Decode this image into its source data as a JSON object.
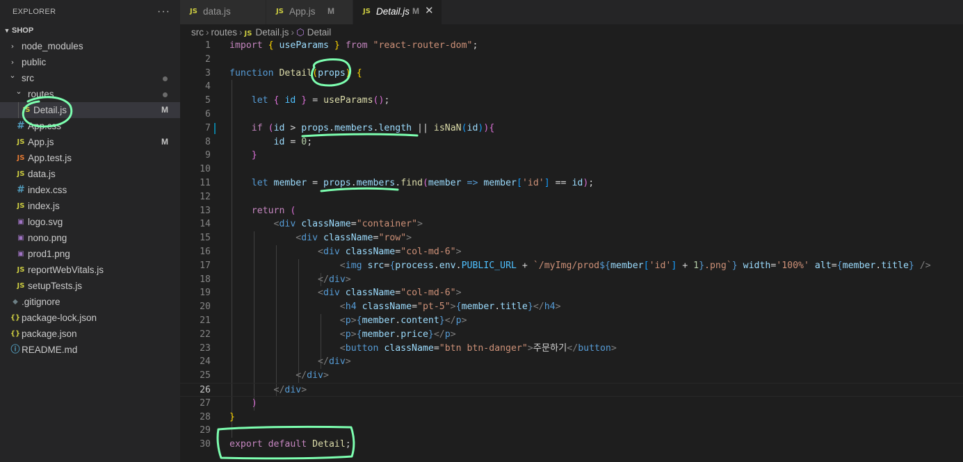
{
  "explorer": {
    "title": "EXPLORER",
    "more": "···",
    "project": "SHOP",
    "items": [
      {
        "label": "node_modules",
        "kind": "folder",
        "icon": "chevron-right-icon",
        "glyph": "›",
        "depth": 0
      },
      {
        "label": "public",
        "kind": "folder",
        "icon": "chevron-right-icon",
        "glyph": "›",
        "depth": 0
      },
      {
        "label": "src",
        "kind": "folder",
        "icon": "chevron-down-icon",
        "glyph": "⌄",
        "depth": 0,
        "dot": true
      },
      {
        "label": "routes",
        "kind": "folder",
        "icon": "chevron-down-icon",
        "glyph": "⌄",
        "depth": 1,
        "dot": true
      },
      {
        "label": "Detail.js",
        "kind": "file",
        "icon": "js-file-icon",
        "glyph": "JS",
        "depth": 2,
        "badge": "M",
        "selected": true
      },
      {
        "label": "App.css",
        "kind": "file",
        "icon": "css-file-icon",
        "glyph": "#",
        "depth": 1
      },
      {
        "label": "App.js",
        "kind": "file",
        "icon": "js-file-icon",
        "glyph": "JS",
        "depth": 1,
        "badge": "M"
      },
      {
        "label": "App.test.js",
        "kind": "file",
        "icon": "test-js-file-icon",
        "glyph": "JS",
        "depth": 1
      },
      {
        "label": "data.js",
        "kind": "file",
        "icon": "js-file-icon",
        "glyph": "JS",
        "depth": 1
      },
      {
        "label": "index.css",
        "kind": "file",
        "icon": "css-file-icon",
        "glyph": "#",
        "depth": 1
      },
      {
        "label": "index.js",
        "kind": "file",
        "icon": "js-file-icon",
        "glyph": "JS",
        "depth": 1
      },
      {
        "label": "logo.svg",
        "kind": "file",
        "icon": "image-file-icon",
        "glyph": "▣",
        "depth": 1
      },
      {
        "label": "nono.png",
        "kind": "file",
        "icon": "image-file-icon",
        "glyph": "▣",
        "depth": 1
      },
      {
        "label": "prod1.png",
        "kind": "file",
        "icon": "image-file-icon",
        "glyph": "▣",
        "depth": 1
      },
      {
        "label": "reportWebVitals.js",
        "kind": "file",
        "icon": "js-file-icon",
        "glyph": "JS",
        "depth": 1
      },
      {
        "label": "setupTests.js",
        "kind": "file",
        "icon": "js-file-icon",
        "glyph": "JS",
        "depth": 1
      },
      {
        "label": ".gitignore",
        "kind": "file",
        "icon": "git-icon",
        "glyph": "◆",
        "depth": 0
      },
      {
        "label": "package-lock.json",
        "kind": "file",
        "icon": "json-file-icon",
        "glyph": "{}",
        "depth": 0
      },
      {
        "label": "package.json",
        "kind": "file",
        "icon": "json-file-icon",
        "glyph": "{}",
        "depth": 0
      },
      {
        "label": "README.md",
        "kind": "file",
        "icon": "info-icon",
        "glyph": "ⓘ",
        "depth": 0
      }
    ]
  },
  "tabs": [
    {
      "label": "data.js",
      "icon": "JS",
      "modified": "",
      "active": false
    },
    {
      "label": "App.js",
      "icon": "JS",
      "modified": "M",
      "active": false
    },
    {
      "label": "Detail.js",
      "icon": "JS",
      "modified": "M",
      "active": true,
      "close": "✕"
    }
  ],
  "breadcrumb": {
    "parts": [
      "src",
      "routes",
      "Detail.js",
      "Detail"
    ],
    "file_icon": "JS",
    "symbol_icon": "⬡"
  },
  "editor": {
    "current_line": 26,
    "modified_lines": [
      7
    ],
    "lines": [
      {
        "n": "1",
        "t": [
          [
            "kw",
            "import"
          ],
          [
            "tx",
            " "
          ],
          [
            "br1",
            "{"
          ],
          [
            "tx",
            " "
          ],
          [
            "vr",
            "useParams"
          ],
          [
            "tx",
            " "
          ],
          [
            "br1",
            "}"
          ],
          [
            "tx",
            " "
          ],
          [
            "kw",
            "from"
          ],
          [
            "tx",
            " "
          ],
          [
            "st",
            "\"react-router-dom\""
          ],
          [
            "tx",
            ";"
          ]
        ]
      },
      {
        "n": "2",
        "t": []
      },
      {
        "n": "3",
        "t": [
          [
            "kb",
            "function"
          ],
          [
            "tx",
            " "
          ],
          [
            "fn",
            "Detail"
          ],
          [
            "br1",
            "("
          ],
          [
            "vr",
            "props"
          ],
          [
            "br1",
            ")"
          ],
          [
            "tx",
            " "
          ],
          [
            "br1",
            "{"
          ]
        ]
      },
      {
        "n": "4",
        "t": []
      },
      {
        "n": "5",
        "t": [
          [
            "tx",
            "    "
          ],
          [
            "kb",
            "let"
          ],
          [
            "tx",
            " "
          ],
          [
            "br2",
            "{"
          ],
          [
            "tx",
            " "
          ],
          [
            "cn",
            "id"
          ],
          [
            "tx",
            " "
          ],
          [
            "br2",
            "}"
          ],
          [
            "tx",
            " = "
          ],
          [
            "fn",
            "useParams"
          ],
          [
            "br2",
            "("
          ],
          [
            "br2",
            ")"
          ],
          [
            "tx",
            ";"
          ]
        ]
      },
      {
        "n": "6",
        "t": []
      },
      {
        "n": "7",
        "t": [
          [
            "tx",
            "    "
          ],
          [
            "kw",
            "if"
          ],
          [
            "tx",
            " "
          ],
          [
            "br2",
            "("
          ],
          [
            "vr",
            "id"
          ],
          [
            "tx",
            " > "
          ],
          [
            "vr",
            "props"
          ],
          [
            "tx",
            "."
          ],
          [
            "vr",
            "members"
          ],
          [
            "tx",
            "."
          ],
          [
            "vr",
            "length"
          ],
          [
            "tx",
            " || "
          ],
          [
            "fn",
            "isNaN"
          ],
          [
            "br3",
            "("
          ],
          [
            "vr",
            "id"
          ],
          [
            "br3",
            ")"
          ],
          [
            "br2",
            ")"
          ],
          [
            "br2",
            "{"
          ]
        ]
      },
      {
        "n": "8",
        "t": [
          [
            "tx",
            "        "
          ],
          [
            "vr",
            "id"
          ],
          [
            "tx",
            " = "
          ],
          [
            "nm",
            "0"
          ],
          [
            "tx",
            ";"
          ]
        ]
      },
      {
        "n": "9",
        "t": [
          [
            "tx",
            "    "
          ],
          [
            "br2",
            "}"
          ]
        ]
      },
      {
        "n": "10",
        "t": []
      },
      {
        "n": "11",
        "t": [
          [
            "tx",
            "    "
          ],
          [
            "kb",
            "let"
          ],
          [
            "tx",
            " "
          ],
          [
            "vr",
            "member"
          ],
          [
            "tx",
            " = "
          ],
          [
            "vr",
            "props"
          ],
          [
            "tx",
            "."
          ],
          [
            "vr",
            "members"
          ],
          [
            "tx",
            "."
          ],
          [
            "fn",
            "find"
          ],
          [
            "br2",
            "("
          ],
          [
            "vr",
            "member"
          ],
          [
            "tx",
            " "
          ],
          [
            "kb",
            "=>"
          ],
          [
            "tx",
            " "
          ],
          [
            "vr",
            "member"
          ],
          [
            "br3",
            "["
          ],
          [
            "st",
            "'id'"
          ],
          [
            "br3",
            "]"
          ],
          [
            "tx",
            " == "
          ],
          [
            "vr",
            "id"
          ],
          [
            "br2",
            ")"
          ],
          [
            "tx",
            ";"
          ]
        ]
      },
      {
        "n": "12",
        "t": []
      },
      {
        "n": "13",
        "t": [
          [
            "tx",
            "    "
          ],
          [
            "kw",
            "return"
          ],
          [
            "tx",
            " "
          ],
          [
            "br2",
            "("
          ]
        ]
      },
      {
        "n": "14",
        "t": [
          [
            "tx",
            "        "
          ],
          [
            "pu",
            "<"
          ],
          [
            "tg",
            "div"
          ],
          [
            "tx",
            " "
          ],
          [
            "vr",
            "className"
          ],
          [
            "tx",
            "="
          ],
          [
            "st",
            "\"container\""
          ],
          [
            "pu",
            ">"
          ]
        ]
      },
      {
        "n": "15",
        "t": [
          [
            "tx",
            "            "
          ],
          [
            "pu",
            "<"
          ],
          [
            "tg",
            "div"
          ],
          [
            "tx",
            " "
          ],
          [
            "vr",
            "className"
          ],
          [
            "tx",
            "="
          ],
          [
            "st",
            "\"row\""
          ],
          [
            "pu",
            ">"
          ]
        ]
      },
      {
        "n": "16",
        "t": [
          [
            "tx",
            "                "
          ],
          [
            "pu",
            "<"
          ],
          [
            "tg",
            "div"
          ],
          [
            "tx",
            " "
          ],
          [
            "vr",
            "className"
          ],
          [
            "tx",
            "="
          ],
          [
            "st",
            "\"col-md-6\""
          ],
          [
            "pu",
            ">"
          ]
        ]
      },
      {
        "n": "17",
        "t": [
          [
            "tx",
            "                    "
          ],
          [
            "pu",
            "<"
          ],
          [
            "tg",
            "img"
          ],
          [
            "tx",
            " "
          ],
          [
            "vr",
            "src"
          ],
          [
            "tx",
            "="
          ],
          [
            "kb",
            "{"
          ],
          [
            "vr",
            "process"
          ],
          [
            "tx",
            "."
          ],
          [
            "vr",
            "env"
          ],
          [
            "tx",
            "."
          ],
          [
            "cn",
            "PUBLIC_URL"
          ],
          [
            "tx",
            " + "
          ],
          [
            "st",
            "`/myImg/prod"
          ],
          [
            "kb",
            "${"
          ],
          [
            "vr",
            "member"
          ],
          [
            "br3",
            "["
          ],
          [
            "st",
            "'id'"
          ],
          [
            "br3",
            "]"
          ],
          [
            "tx",
            " + "
          ],
          [
            "nm",
            "1"
          ],
          [
            "kb",
            "}"
          ],
          [
            "st",
            ".png`"
          ],
          [
            "kb",
            "}"
          ],
          [
            "tx",
            " "
          ],
          [
            "vr",
            "width"
          ],
          [
            "tx",
            "="
          ],
          [
            "st",
            "'100%'"
          ],
          [
            "tx",
            " "
          ],
          [
            "vr",
            "alt"
          ],
          [
            "tx",
            "="
          ],
          [
            "kb",
            "{"
          ],
          [
            "vr",
            "member"
          ],
          [
            "tx",
            "."
          ],
          [
            "vr",
            "title"
          ],
          [
            "kb",
            "}"
          ],
          [
            "tx",
            " "
          ],
          [
            "pu",
            "/>"
          ]
        ]
      },
      {
        "n": "18",
        "t": [
          [
            "tx",
            "                "
          ],
          [
            "pu",
            "</"
          ],
          [
            "tg",
            "div"
          ],
          [
            "pu",
            ">"
          ]
        ]
      },
      {
        "n": "19",
        "t": [
          [
            "tx",
            "                "
          ],
          [
            "pu",
            "<"
          ],
          [
            "tg",
            "div"
          ],
          [
            "tx",
            " "
          ],
          [
            "vr",
            "className"
          ],
          [
            "tx",
            "="
          ],
          [
            "st",
            "\"col-md-6\""
          ],
          [
            "pu",
            ">"
          ]
        ]
      },
      {
        "n": "20",
        "t": [
          [
            "tx",
            "                    "
          ],
          [
            "pu",
            "<"
          ],
          [
            "tg",
            "h4"
          ],
          [
            "tx",
            " "
          ],
          [
            "vr",
            "className"
          ],
          [
            "tx",
            "="
          ],
          [
            "st",
            "\"pt-5\""
          ],
          [
            "pu",
            ">"
          ],
          [
            "kb",
            "{"
          ],
          [
            "vr",
            "member"
          ],
          [
            "tx",
            "."
          ],
          [
            "vr",
            "title"
          ],
          [
            "kb",
            "}"
          ],
          [
            "pu",
            "</"
          ],
          [
            "tg",
            "h4"
          ],
          [
            "pu",
            ">"
          ]
        ]
      },
      {
        "n": "21",
        "t": [
          [
            "tx",
            "                    "
          ],
          [
            "pu",
            "<"
          ],
          [
            "tg",
            "p"
          ],
          [
            "pu",
            ">"
          ],
          [
            "kb",
            "{"
          ],
          [
            "vr",
            "member"
          ],
          [
            "tx",
            "."
          ],
          [
            "vr",
            "content"
          ],
          [
            "kb",
            "}"
          ],
          [
            "pu",
            "</"
          ],
          [
            "tg",
            "p"
          ],
          [
            "pu",
            ">"
          ]
        ]
      },
      {
        "n": "22",
        "t": [
          [
            "tx",
            "                    "
          ],
          [
            "pu",
            "<"
          ],
          [
            "tg",
            "p"
          ],
          [
            "pu",
            ">"
          ],
          [
            "kb",
            "{"
          ],
          [
            "vr",
            "member"
          ],
          [
            "tx",
            "."
          ],
          [
            "vr",
            "price"
          ],
          [
            "kb",
            "}"
          ],
          [
            "pu",
            "</"
          ],
          [
            "tg",
            "p"
          ],
          [
            "pu",
            ">"
          ]
        ]
      },
      {
        "n": "23",
        "t": [
          [
            "tx",
            "                    "
          ],
          [
            "pu",
            "<"
          ],
          [
            "tg",
            "button"
          ],
          [
            "tx",
            " "
          ],
          [
            "vr",
            "className"
          ],
          [
            "tx",
            "="
          ],
          [
            "st",
            "\"btn btn-danger\""
          ],
          [
            "pu",
            ">"
          ],
          [
            "tx",
            "주문하기"
          ],
          [
            "pu",
            "</"
          ],
          [
            "tg",
            "button"
          ],
          [
            "pu",
            ">"
          ]
        ]
      },
      {
        "n": "24",
        "t": [
          [
            "tx",
            "                "
          ],
          [
            "pu",
            "</"
          ],
          [
            "tg",
            "div"
          ],
          [
            "pu",
            ">"
          ]
        ]
      },
      {
        "n": "25",
        "t": [
          [
            "tx",
            "            "
          ],
          [
            "pu",
            "</"
          ],
          [
            "tg",
            "div"
          ],
          [
            "pu",
            ">"
          ]
        ]
      },
      {
        "n": "26",
        "t": [
          [
            "tx",
            "        "
          ],
          [
            "pu",
            "</"
          ],
          [
            "tg",
            "div"
          ],
          [
            "pu",
            ">"
          ]
        ]
      },
      {
        "n": "27",
        "t": [
          [
            "tx",
            "    "
          ],
          [
            "br2",
            ")"
          ]
        ]
      },
      {
        "n": "28",
        "t": [
          [
            "br1",
            "}"
          ]
        ]
      },
      {
        "n": "29",
        "t": []
      },
      {
        "n": "30",
        "t": [
          [
            "kw",
            "export"
          ],
          [
            "tx",
            " "
          ],
          [
            "kw",
            "default"
          ],
          [
            "tx",
            " "
          ],
          [
            "fn",
            "Detail"
          ],
          [
            "tx",
            ";"
          ]
        ]
      }
    ]
  },
  "colors": {
    "annotation": "#7dffb0"
  }
}
